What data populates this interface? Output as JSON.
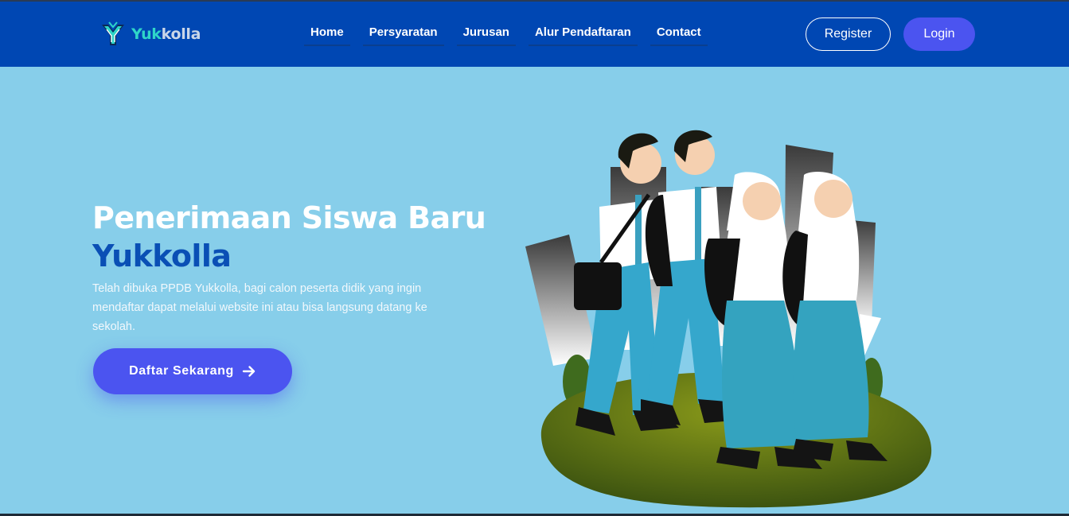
{
  "brand": {
    "name_part1": "Yuk",
    "name_part2": "kolla",
    "logo_icon": "yukkolla-logo-icon"
  },
  "nav": {
    "items": [
      {
        "label": "Home"
      },
      {
        "label": "Persyaratan"
      },
      {
        "label": "Jurusan"
      },
      {
        "label": "Alur Pendaftaran"
      },
      {
        "label": "Contact"
      }
    ],
    "register_label": "Register",
    "login_label": "Login"
  },
  "hero": {
    "title_line1": "Penerimaan Siswa Baru",
    "title_line2": "Yukkolla",
    "description": "Telah dibuka PPDB Yukkolla, bagi calon peserta didik yang ingin mendaftar dapat melalui website ini atau bisa langsung datang ke sekolah.",
    "cta_label": "Daftar Sekarang",
    "cta_icon": "arrow-right-icon",
    "illustration": "students-walking-illustration"
  },
  "colors": {
    "navbar": "#0047b3",
    "hero_background": "#87ceea",
    "accent_button": "#4b54f0",
    "title_highlight": "#0a4fb5",
    "brand_teal": "#2fd6c8"
  }
}
